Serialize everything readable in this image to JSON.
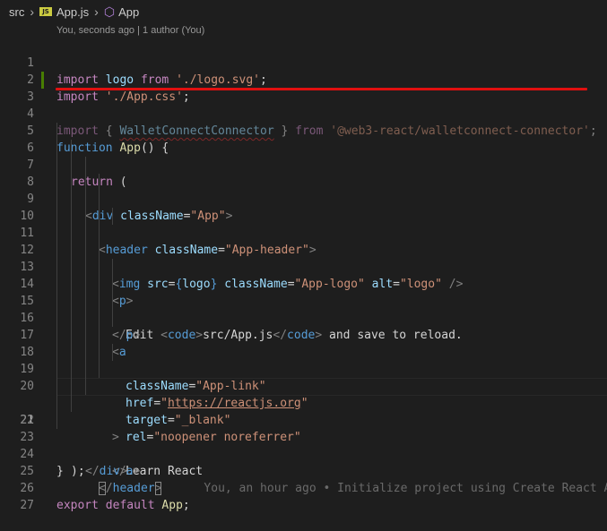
{
  "breadcrumb": {
    "folder": "src",
    "file": "App.js",
    "file_icon_label": "JS",
    "symbol": "App"
  },
  "author_hint": "You, seconds ago | 1 author (You)",
  "editor": {
    "current_line": 21,
    "blame": "You, an hour ago • Initialize project using Create React App",
    "lines": [
      {
        "n": "1"
      },
      {
        "n": "2"
      },
      {
        "n": "3"
      },
      {
        "n": "4"
      },
      {
        "n": "5"
      },
      {
        "n": "6"
      },
      {
        "n": "7"
      },
      {
        "n": "8"
      },
      {
        "n": "9"
      },
      {
        "n": "10"
      },
      {
        "n": "11"
      },
      {
        "n": "12"
      },
      {
        "n": "13"
      },
      {
        "n": "14"
      },
      {
        "n": "15"
      },
      {
        "n": "16"
      },
      {
        "n": "17"
      },
      {
        "n": "18"
      },
      {
        "n": "19"
      },
      {
        "n": "20"
      },
      {
        "n": "21"
      },
      {
        "n": "22"
      },
      {
        "n": "23"
      },
      {
        "n": "24"
      },
      {
        "n": "25"
      },
      {
        "n": "26"
      },
      {
        "n": "27"
      }
    ],
    "tokens": {
      "import": "import",
      "from": "from",
      "function": "function",
      "return": "return",
      "export": "export",
      "default": "default",
      "logo": "logo",
      "logo_path": "'./logo.svg'",
      "css_path": "'./App.css'",
      "wallet_connector": "WalletConnectConnector",
      "wallet_module": "'@web3-react/walletconnect-connector'",
      "app_fn": "App",
      "div": "div",
      "header": "header",
      "img": "img",
      "p": "p",
      "code": "code",
      "a": "a",
      "className": "className",
      "src": "src",
      "alt": "alt",
      "href": "href",
      "target": "target",
      "rel": "rel",
      "app_class": "\"App\"",
      "header_class": "\"App-header\"",
      "logo_class": "\"App-logo\"",
      "alt_value": "\"logo\"",
      "edit_text": "Edit ",
      "code_text": "src/App.js",
      "save_text": " and save to reload.",
      "link_class": "\"App-link\"",
      "href_value": "https://reactjs.org",
      "target_value": "\"_blank\"",
      "rel_value": "\"noopener noreferrer\"",
      "learn_react": "Learn React"
    }
  },
  "colors": {
    "background": "#1e1e1e",
    "keyword": "#c586c0",
    "keyword_blue": "#569cd6",
    "string": "#ce9178",
    "function": "#dcdcaa",
    "variable": "#9cdcfe",
    "git_added": "#487e02",
    "annotation_red": "#e01010"
  }
}
